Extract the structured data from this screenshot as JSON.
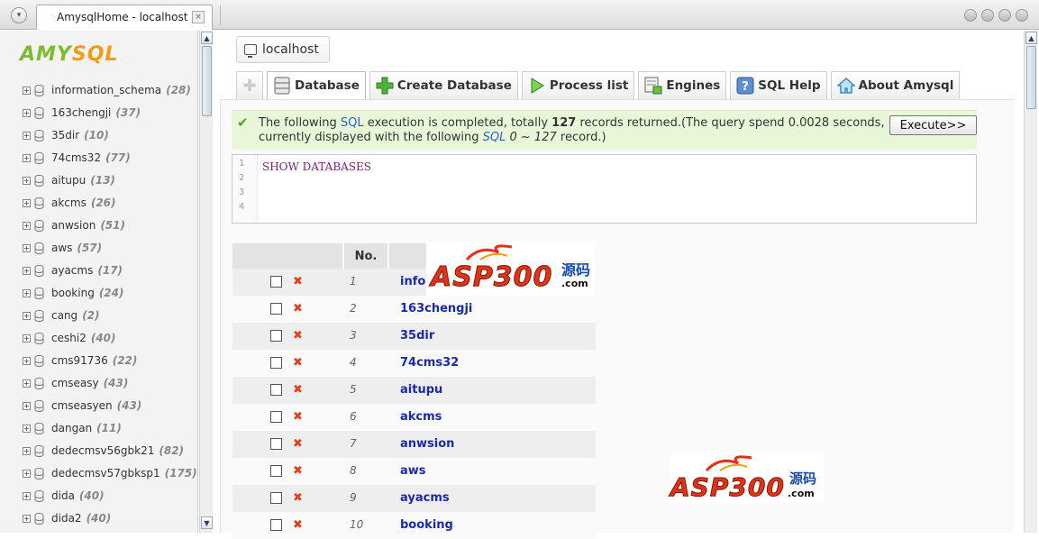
{
  "browser": {
    "tab_title": "AmysqlHome - localhost",
    "tab_close": "×"
  },
  "sidebar": {
    "logo_a": "AMY",
    "logo_b": "SQL",
    "databases": [
      {
        "name": "information_schema",
        "count": "(28)"
      },
      {
        "name": "163chengji",
        "count": "(37)"
      },
      {
        "name": "35dir",
        "count": "(10)"
      },
      {
        "name": "74cms32",
        "count": "(77)"
      },
      {
        "name": "aitupu",
        "count": "(13)"
      },
      {
        "name": "akcms",
        "count": "(26)"
      },
      {
        "name": "anwsion",
        "count": "(51)"
      },
      {
        "name": "aws",
        "count": "(57)"
      },
      {
        "name": "ayacms",
        "count": "(17)"
      },
      {
        "name": "booking",
        "count": "(24)"
      },
      {
        "name": "cang",
        "count": "(2)"
      },
      {
        "name": "ceshi2",
        "count": "(40)"
      },
      {
        "name": "cms91736",
        "count": "(22)"
      },
      {
        "name": "cmseasy",
        "count": "(43)"
      },
      {
        "name": "cmseasyen",
        "count": "(43)"
      },
      {
        "name": "dangan",
        "count": "(11)"
      },
      {
        "name": "dedecmsv56gbk21",
        "count": "(82)"
      },
      {
        "name": "dedecmsv57gbksp1",
        "count": "(175)"
      },
      {
        "name": "dida",
        "count": "(40)"
      },
      {
        "name": "dida2",
        "count": "(40)"
      }
    ]
  },
  "main": {
    "host_label": "localhost",
    "toolbar": [
      {
        "label": "Database",
        "icon": "database-icon"
      },
      {
        "label": "Create Database",
        "icon": "plus-icon"
      },
      {
        "label": "Process list",
        "icon": "play-icon"
      },
      {
        "label": "Engines",
        "icon": "engines-icon"
      },
      {
        "label": "SQL Help",
        "icon": "help-icon"
      },
      {
        "label": "About Amysql",
        "icon": "home-icon"
      }
    ],
    "notice": {
      "line1_a": "The following ",
      "line1_sql": "SQL",
      "line1_b": " execution is completed, totally ",
      "line1_count": "127",
      "line1_c": " records returned.(The query spend 0.0028 seconds,",
      "line2_a": "currently displayed with the following ",
      "line2_sql": "SQL",
      "line2_range": " 0 ~ 127",
      "line2_b": " record.)"
    },
    "execute_label": "Execute>>",
    "editor": {
      "line_numbers": [
        "1",
        "2",
        "3",
        "4"
      ],
      "code": "SHOW DATABASES"
    },
    "table": {
      "header_no": "No.",
      "rows": [
        {
          "no": "1",
          "name": "info"
        },
        {
          "no": "2",
          "name": "163chengji"
        },
        {
          "no": "3",
          "name": "35dir"
        },
        {
          "no": "4",
          "name": "74cms32"
        },
        {
          "no": "5",
          "name": "aitupu"
        },
        {
          "no": "6",
          "name": "akcms"
        },
        {
          "no": "7",
          "name": "anwsion"
        },
        {
          "no": "8",
          "name": "aws"
        },
        {
          "no": "9",
          "name": "ayacms"
        },
        {
          "no": "10",
          "name": "booking"
        }
      ]
    },
    "watermark": {
      "brand": "ASP300",
      "cn": "源码",
      "com": ".com"
    }
  }
}
